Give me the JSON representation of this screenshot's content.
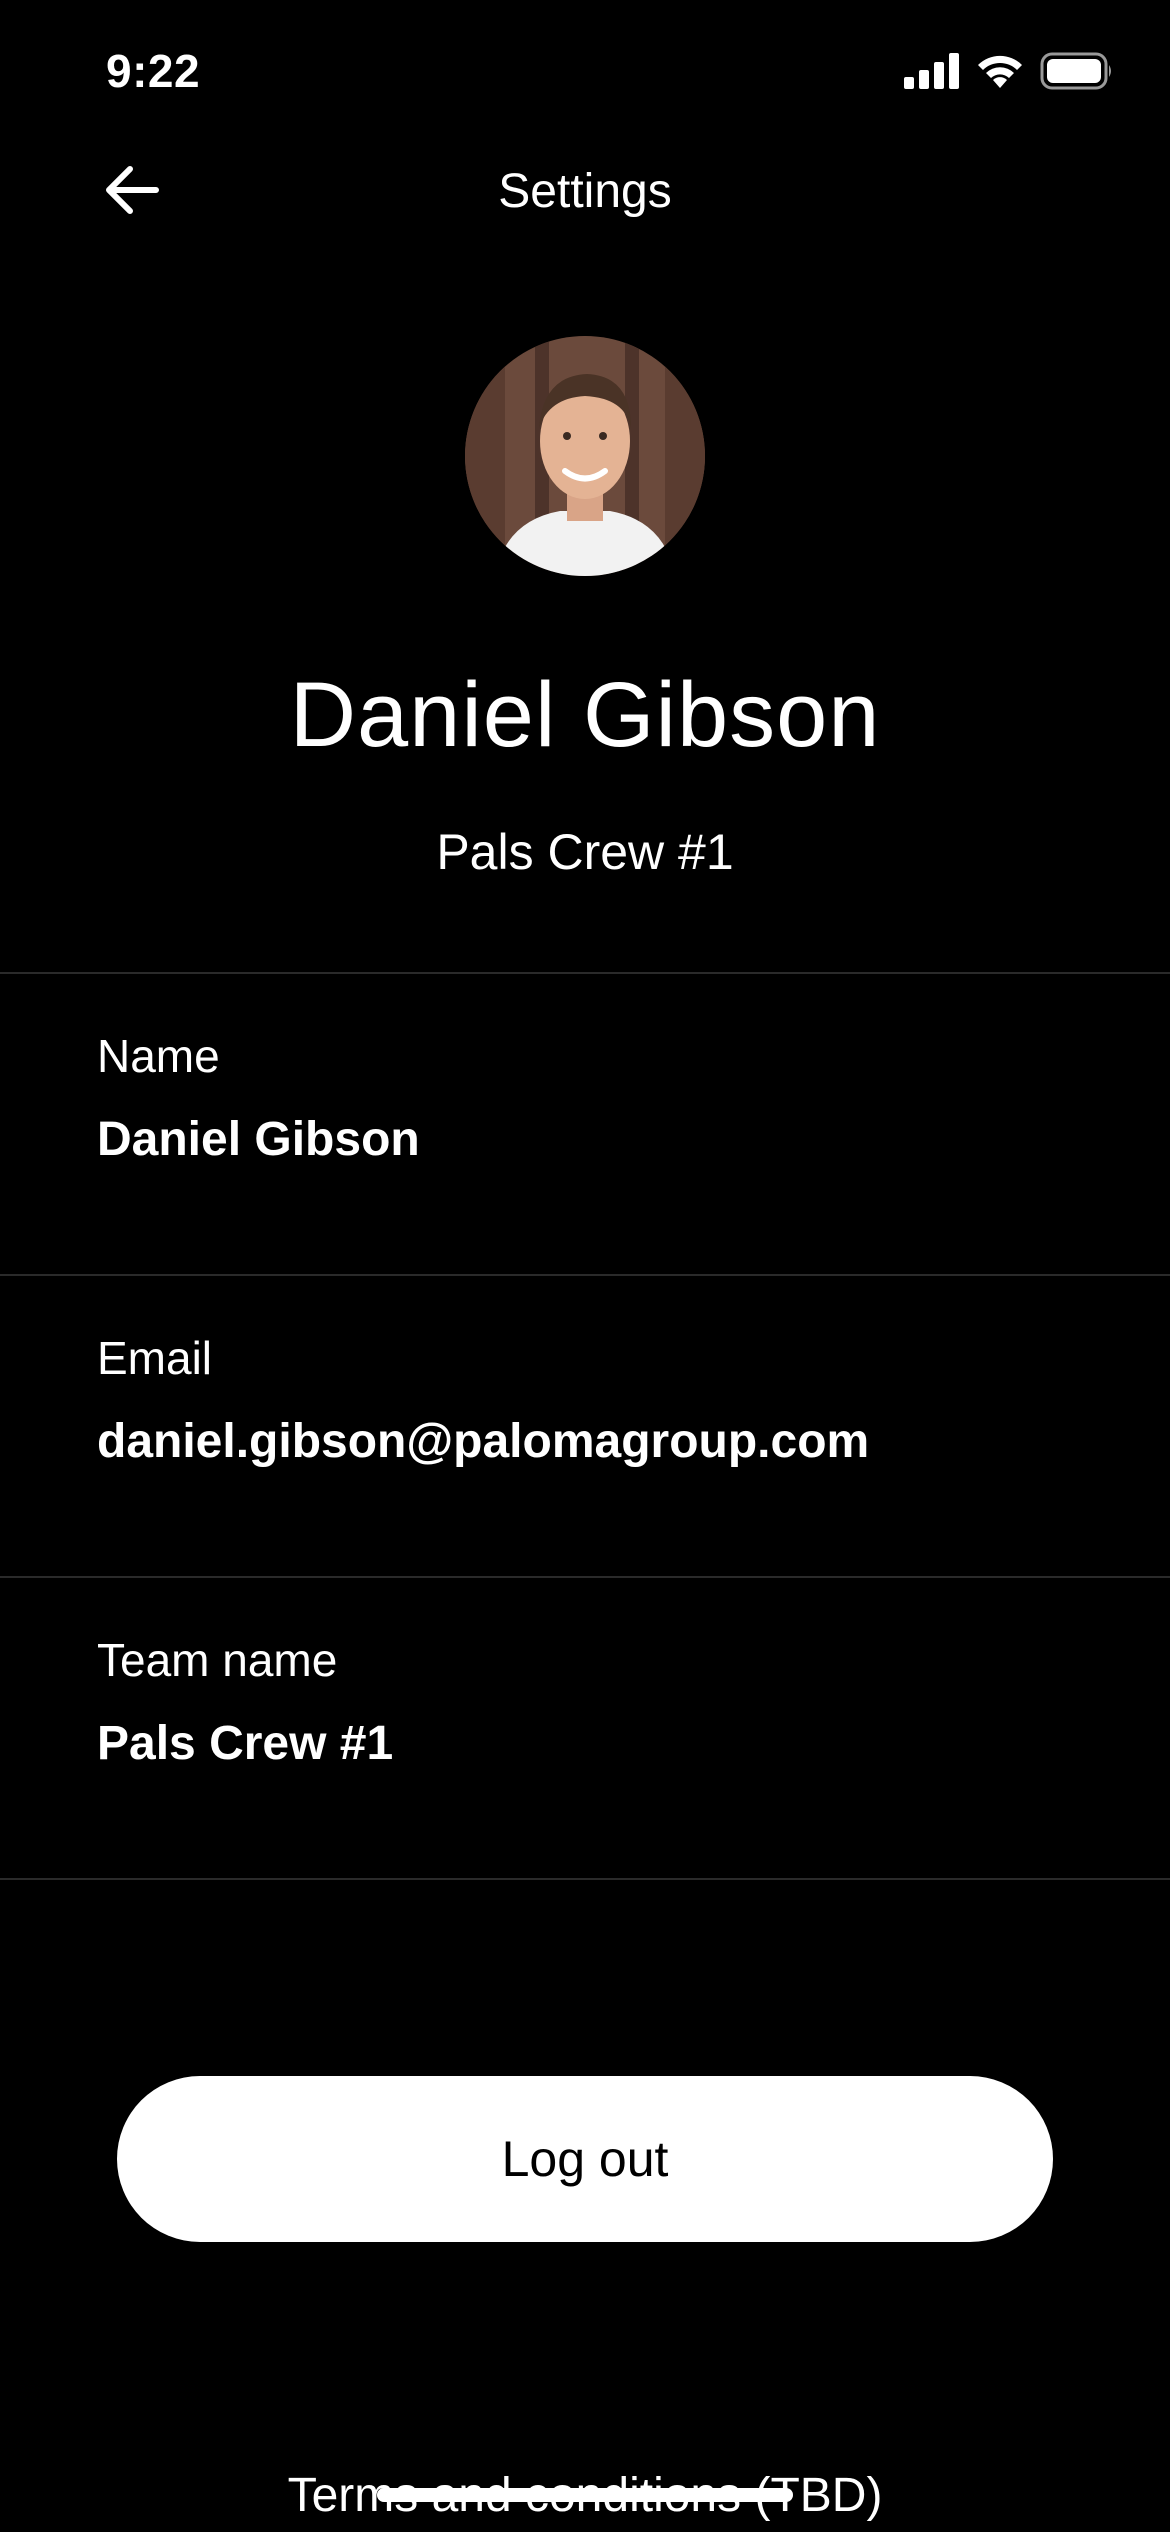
{
  "status_bar": {
    "time": "9:22",
    "icons": [
      "cellular-signal-icon",
      "wifi-icon",
      "battery-icon"
    ]
  },
  "nav": {
    "back_icon": "arrow-left-icon",
    "title": "Settings"
  },
  "profile": {
    "name": "Daniel Gibson",
    "team": "Pals Crew #1"
  },
  "fields": [
    {
      "label": "Name",
      "value": "Daniel Gibson"
    },
    {
      "label": "Email",
      "value": "daniel.gibson@palomagroup.com"
    },
    {
      "label": "Team name",
      "value": "Pals Crew #1"
    }
  ],
  "actions": {
    "logout_label": "Log out",
    "terms_label": "Terms and conditions (TBD)"
  },
  "colors": {
    "background": "#000000",
    "text": "#ffffff",
    "button_bg": "#ffffff",
    "button_text": "#000000",
    "divider": "#2a2a2a"
  }
}
